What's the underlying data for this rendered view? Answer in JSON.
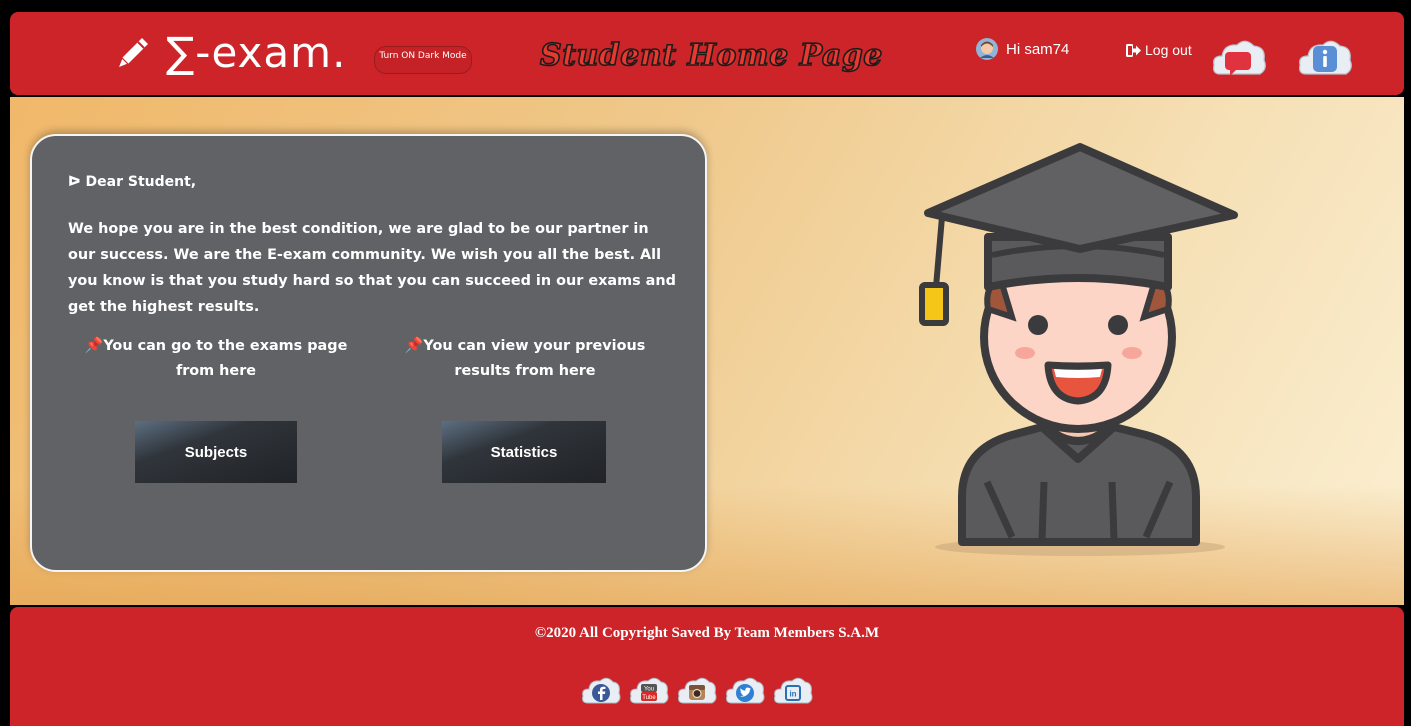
{
  "header": {
    "brand_name": "∑-exam.",
    "dark_mode_toggle": "Turn ON Dark Mode",
    "page_title": "Student Home Page",
    "user_greeting": "Hi sam74",
    "logout_label": "Log out",
    "icons": [
      "pencil-icon",
      "user-avatar-icon",
      "logout-icon",
      "message-cloud-icon",
      "info-cloud-icon"
    ]
  },
  "card": {
    "greeting": "ᐅ Dear Student,",
    "body": "We hope you are in the best condition, we are glad to be our partner in our success. We are the E-exam community. We wish you all the best. All you know is that you study hard so that you can succeed in our exams and get the highest results.",
    "note_left": "You can go to the exams page from here",
    "note_right": "You can view your previous results from here",
    "pin_icon": "📌",
    "subjects_button": "Subjects",
    "statistics_button": "Statistics"
  },
  "footer": {
    "copyright": "©2020 All Copyright Saved By Team Members S.A.M",
    "socials": [
      "facebook-icon",
      "youtube-icon",
      "instagram-icon",
      "twitter-icon",
      "linkedin-icon"
    ]
  },
  "colors": {
    "header_red": "#cc2428",
    "card_gray": "#616266",
    "background_orange": "#f0b86a",
    "background_cream": "#fbefd2"
  }
}
